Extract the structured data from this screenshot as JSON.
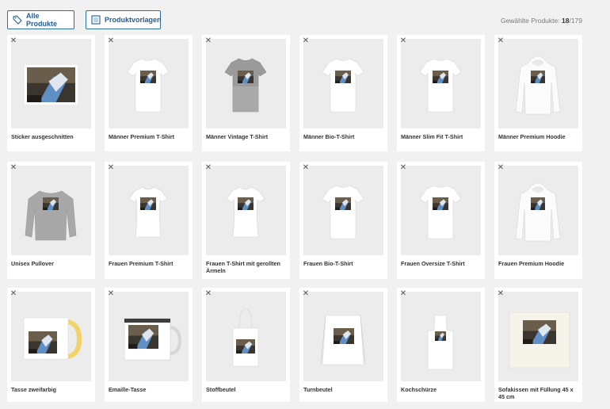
{
  "toolbar": {
    "all_products_label": "Alle Produkte",
    "templates_label": "Produktvorlagen",
    "selected_label": "Gewählte Produkte:",
    "selected_count": "18",
    "total_count": "/179"
  },
  "products": [
    {
      "name": "Sticker ausgeschnitten",
      "type": "sticker"
    },
    {
      "name": "Männer Premium T-Shirt",
      "type": "tshirt-white"
    },
    {
      "name": "Männer Vintage T-Shirt",
      "type": "tshirt-grey"
    },
    {
      "name": "Männer Bio-T-Shirt",
      "type": "tshirt-white"
    },
    {
      "name": "Männer Slim Fit T-Shirt",
      "type": "tshirt-white"
    },
    {
      "name": "Männer Premium Hoodie",
      "type": "hoodie"
    },
    {
      "name": "Unisex Pullover",
      "type": "sweater-grey"
    },
    {
      "name": "Frauen Premium T-Shirt",
      "type": "tshirt-women"
    },
    {
      "name": "Frauen T-Shirt mit gerollten Ärmeln",
      "type": "tshirt-women"
    },
    {
      "name": "Frauen Bio-T-Shirt",
      "type": "tshirt-white"
    },
    {
      "name": "Frauen Oversize T-Shirt",
      "type": "tshirt-white"
    },
    {
      "name": "Frauen Premium Hoodie",
      "type": "hoodie"
    },
    {
      "name": "Tasse zweifarbig",
      "type": "mug-yellow"
    },
    {
      "name": "Emaille-Tasse",
      "type": "mug-enamel"
    },
    {
      "name": "Stoffbeutel",
      "type": "tote-bag"
    },
    {
      "name": "Turnbeutel",
      "type": "gym-bag"
    },
    {
      "name": "Kochschürze",
      "type": "apron"
    },
    {
      "name": "Sofakissen mit Füllung 45 x 45 cm",
      "type": "pillow"
    }
  ],
  "icons": {
    "remove": "close-icon",
    "all_products": "tag-icon",
    "templates": "template-icon"
  },
  "colors": {
    "accent": "#2c6fa8",
    "background": "#f1f1f1"
  }
}
